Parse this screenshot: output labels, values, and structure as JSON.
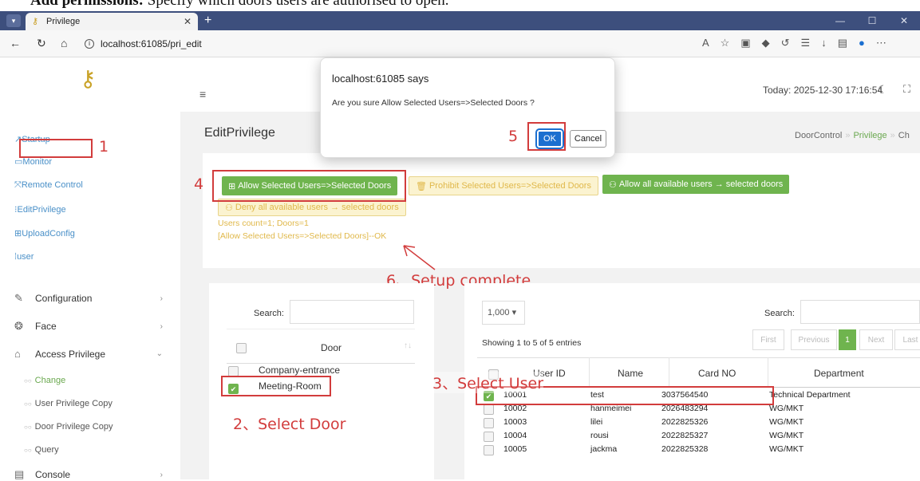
{
  "caption": {
    "bold": "Add permissions:",
    "text": " Specify which doors users are authorised to open."
  },
  "browser": {
    "tab_title": "Privilege",
    "url": "localhost:61085/pri_edit"
  },
  "sidebar": {
    "plain_items": [
      "Startup",
      "Monitor",
      "Remote Control",
      "EditPrivilege",
      "UploadConfig",
      "user"
    ],
    "items": [
      {
        "label": "Configuration",
        "chevron": "›"
      },
      {
        "label": "Face",
        "chevron": "›"
      },
      {
        "label": "Access Privilege",
        "chevron": "⌄"
      },
      {
        "label": "Console",
        "chevron": "›"
      }
    ],
    "sub_items": [
      "Change",
      "User Privilege Copy",
      "Door Privilege Copy",
      "Query"
    ]
  },
  "header": {
    "today": "Today: 2025-12-30 17:16:54"
  },
  "page": {
    "title": "EditPrivilege",
    "breadcrumb": [
      "DoorControl",
      "Privilege",
      "Ch"
    ]
  },
  "actions": {
    "allow_selected": "Allow Selected Users=>Selected Doors",
    "prohibit_selected": "Prohibit Selected Users=>Selected Doors",
    "allow_all": "Allow all available users → selected doors",
    "deny_all": "Deny all available users → selected doors",
    "status_count": "Users count=1; Doors=1",
    "status_result": "[Allow Selected Users=>Selected Doors]--OK"
  },
  "doors": {
    "search_label": "Search:",
    "column": "Door",
    "rows": [
      {
        "name": "Company-entrance",
        "checked": false
      },
      {
        "name": "Meeting-Room",
        "checked": true
      }
    ]
  },
  "users": {
    "page_size": "1,000 ▾",
    "search_label": "Search:",
    "info": "Showing 1 to 5 of 5 entries",
    "pager": [
      "First",
      "Previous",
      "1",
      "Next",
      "Last"
    ],
    "columns": [
      "User ID",
      "Name",
      "Card NO",
      "Department"
    ],
    "rows": [
      {
        "id": "10001",
        "name": "test",
        "card": "3037564540",
        "dept": "Technical Department",
        "checked": true
      },
      {
        "id": "10002",
        "name": "hanmeimei",
        "card": "2026483294",
        "dept": "WG/MKT",
        "checked": false
      },
      {
        "id": "10003",
        "name": "lilei",
        "card": "2022825326",
        "dept": "WG/MKT",
        "checked": false
      },
      {
        "id": "10004",
        "name": "rousi",
        "card": "2022825327",
        "dept": "WG/MKT",
        "checked": false
      },
      {
        "id": "10005",
        "name": "jackma",
        "card": "2022825328",
        "dept": "WG/MKT",
        "checked": false
      }
    ]
  },
  "dialog": {
    "title": "localhost:61085 says",
    "message": "Are you sure Allow Selected Users=>Selected Doors ?",
    "ok": "OK",
    "cancel": "Cancel"
  },
  "annotations": {
    "step1": "1",
    "step2": "2、Select Door",
    "step3": "3、Select User",
    "step4": "4",
    "step5": "5",
    "step6": "6、Setup complete"
  },
  "colors": {
    "accent_green": "#6fb44e",
    "annotation_red": "#d23c3c",
    "dialog_blue": "#1b6fd0"
  }
}
